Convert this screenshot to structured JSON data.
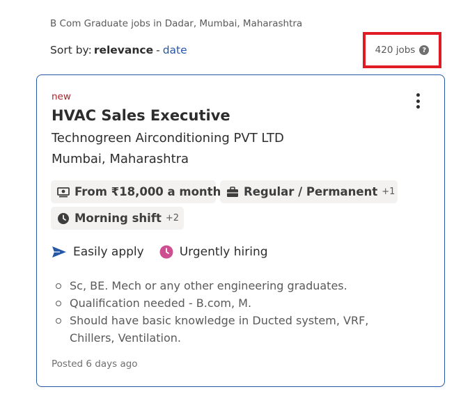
{
  "breadcrumb": "B Com Graduate jobs in Dadar, Mumbai, Maharashtra",
  "sort": {
    "label": "Sort by:",
    "active": "relevance",
    "separator": "-",
    "alternative": "date"
  },
  "job_count": {
    "text": "420 jobs",
    "help_icon": "?",
    "highlight_color": "#e01b24"
  },
  "job": {
    "badge": "new",
    "title": "HVAC Sales Executive",
    "company": "Technogreen Airconditioning PVT LTD",
    "location": "Mumbai, Maharashtra",
    "tags": {
      "salary": {
        "icon": "money-icon",
        "label": "From ₹18,000 a month"
      },
      "job_type": {
        "icon": "briefcase-icon",
        "label": "Regular / Permanent",
        "more": "+1"
      },
      "shift": {
        "icon": "clock-icon",
        "label": "Morning shift",
        "more": "+2"
      }
    },
    "features": {
      "easy_apply": {
        "icon": "send-icon",
        "label": "Easily apply",
        "color": "#2557a7"
      },
      "urgent": {
        "icon": "clock-icon",
        "label": "Urgently hiring",
        "color": "#cd4f8f"
      }
    },
    "snippet": [
      "Sc, BE. Mech or any other engineering graduates.",
      "Qualification needed - B.com, M.",
      "Should have basic knowledge in Ducted system, VRF, Chillers, Ventilation."
    ],
    "posted": "Posted 6 days ago"
  },
  "colors": {
    "card_border": "#2557a7",
    "link": "#2557a7",
    "new_badge": "#a9252b"
  }
}
